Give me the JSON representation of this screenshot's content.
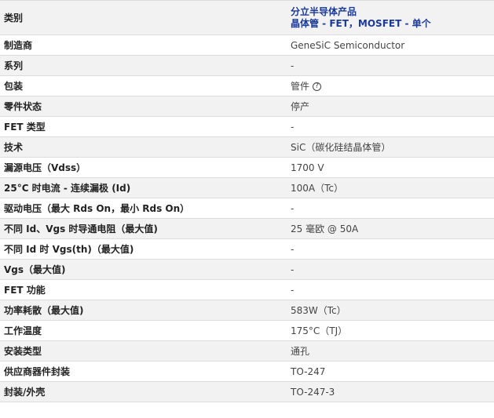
{
  "header": {
    "label": "类别",
    "category_line1": "分立半导体产品",
    "category_line2": "晶体管 - FET，MOSFET - 单个"
  },
  "rows": [
    {
      "label": "制造商",
      "value": "GeneSiC Semiconductor"
    },
    {
      "label": "系列",
      "value": "-"
    },
    {
      "label": "包装",
      "value": "管件"
    },
    {
      "label": "零件状态",
      "value": "停产"
    },
    {
      "label": "FET 类型",
      "value": "-"
    },
    {
      "label": "技术",
      "value": "SiC（碳化硅结晶体管）"
    },
    {
      "label": "漏源电压（Vdss）",
      "value": "1700 V"
    },
    {
      "label": "25°C 时电流 - 连续漏极 (Id)",
      "value": "100A（Tc）"
    },
    {
      "label": "驱动电压（最大 Rds On，最小 Rds On）",
      "value": "-"
    },
    {
      "label": "不同 Id、Vgs 时导通电阻（最大值)",
      "value": "25 毫欧 @ 50A"
    },
    {
      "label": "不同 Id 时 Vgs(th)（最大值)",
      "value": "-"
    },
    {
      "label": "Vgs（最大值)",
      "value": "-"
    },
    {
      "label": "FET 功能",
      "value": "-"
    },
    {
      "label": "功率耗散（最大值)",
      "value": "583W（Tc）"
    },
    {
      "label": "工作温度",
      "value": "175°C（TJ）"
    },
    {
      "label": "安装类型",
      "value": "通孔"
    },
    {
      "label": "供应商器件封装",
      "value": "TO-247"
    },
    {
      "label": "封装/外壳",
      "value": "TO-247-3"
    }
  ],
  "icons": {
    "packaging_help": "question-circle-icon"
  }
}
